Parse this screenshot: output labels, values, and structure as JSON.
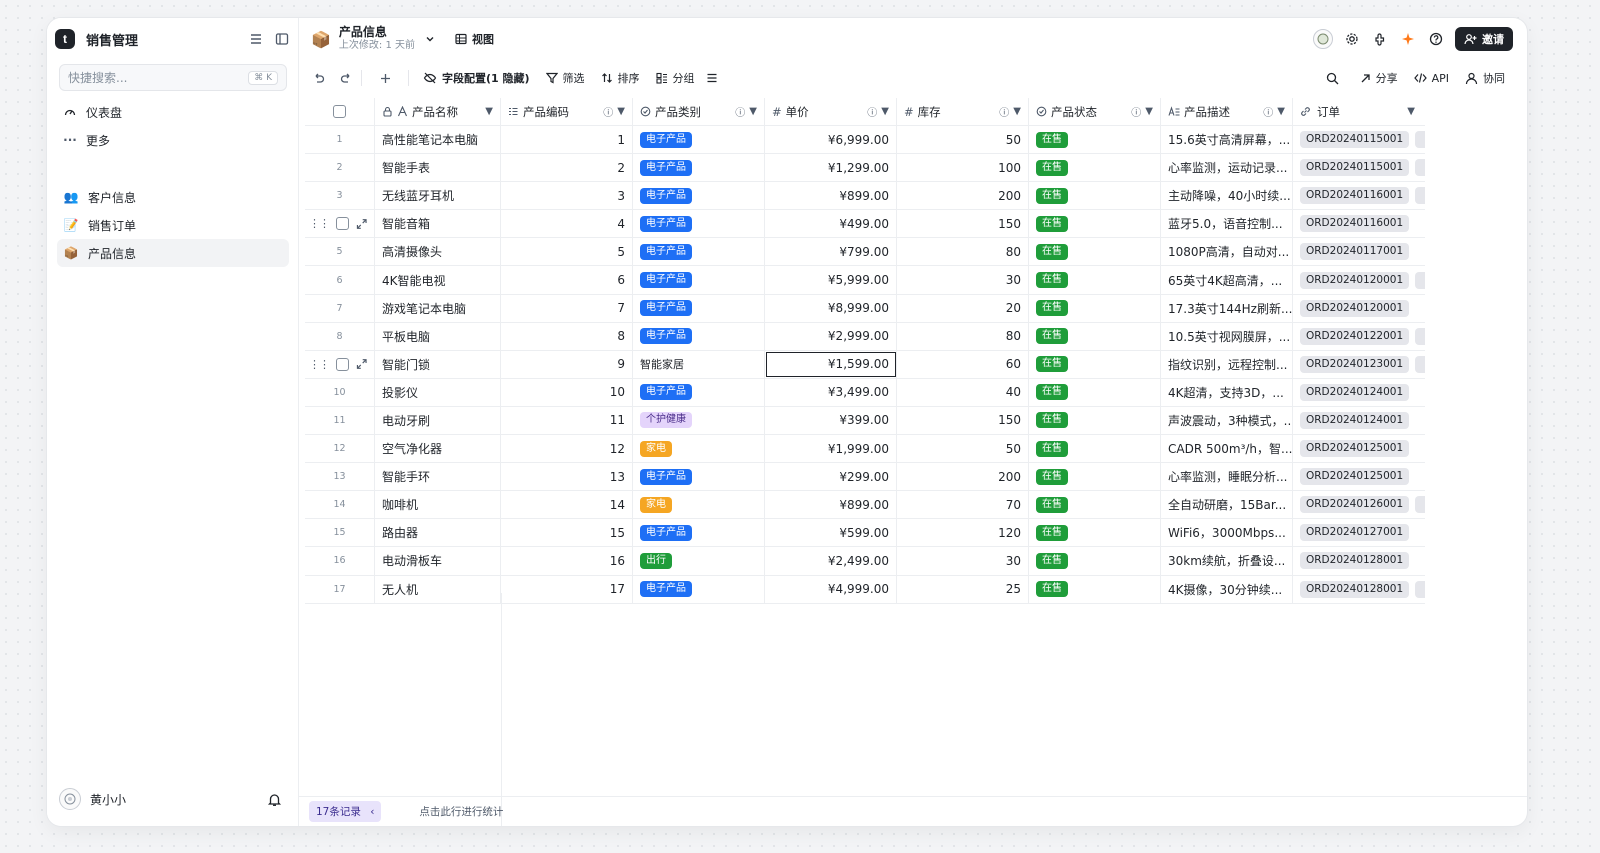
{
  "sidebar": {
    "app_logo": "t",
    "app_title": "销售管理",
    "search_placeholder": "快捷搜索...",
    "search_shortcut": "⌘ K",
    "top_items": [
      {
        "icon": "dashboard-icon",
        "label": "仪表盘"
      },
      {
        "icon": "more-icon",
        "label": "更多"
      }
    ],
    "tables": [
      {
        "emoji": "👥",
        "label": "客户信息"
      },
      {
        "emoji": "📝",
        "label": "销售订单"
      },
      {
        "emoji": "📦",
        "label": "产品信息"
      }
    ],
    "user_name": "黄小小"
  },
  "header": {
    "table_emoji": "📦",
    "table_title": "产品信息",
    "last_modified": "上次修改: 1 天前",
    "view_label": "视图",
    "invite_label": "邀请"
  },
  "toolbar": {
    "field_config": "字段配置(1 隐藏)",
    "filter": "筛选",
    "sort": "排序",
    "group": "分组",
    "share": "分享",
    "api": "API",
    "collab": "协同"
  },
  "columns": [
    "产品名称",
    "产品编码",
    "产品类别",
    "单价",
    "库存",
    "产品状态",
    "产品描述",
    "订单"
  ],
  "rows": [
    {
      "n": "1",
      "name": "高性能笔记本电脑",
      "code": "1",
      "cat": "电子产品",
      "catColor": "#1e6ff5",
      "price": "¥6,999.00",
      "stock": "50",
      "status": "在售",
      "desc": "15.6英寸高清屏幕，...",
      "order": "ORD20240115001",
      "more": true
    },
    {
      "n": "2",
      "name": "智能手表",
      "code": "2",
      "cat": "电子产品",
      "catColor": "#1e6ff5",
      "price": "¥1,299.00",
      "stock": "100",
      "status": "在售",
      "desc": "心率监测，运动记录...",
      "order": "ORD20240115001",
      "more": true
    },
    {
      "n": "3",
      "name": "无线蓝牙耳机",
      "code": "3",
      "cat": "电子产品",
      "catColor": "#1e6ff5",
      "price": "¥899.00",
      "stock": "200",
      "status": "在售",
      "desc": "主动降噪，40小时续...",
      "order": "ORD20240116001",
      "more": true
    },
    {
      "n": "",
      "name": "智能音箱",
      "code": "4",
      "cat": "电子产品",
      "catColor": "#1e6ff5",
      "price": "¥499.00",
      "stock": "150",
      "status": "在售",
      "desc": "蓝牙5.0，语音控制...",
      "order": "ORD20240116001",
      "more": false
    },
    {
      "n": "5",
      "name": "高清摄像头",
      "code": "5",
      "cat": "电子产品",
      "catColor": "#1e6ff5",
      "price": "¥799.00",
      "stock": "80",
      "status": "在售",
      "desc": "1080P高清，自动对...",
      "order": "ORD20240117001",
      "more": false
    },
    {
      "n": "6",
      "name": "4K智能电视",
      "code": "6",
      "cat": "电子产品",
      "catColor": "#1e6ff5",
      "price": "¥5,999.00",
      "stock": "30",
      "status": "在售",
      "desc": "65英寸4K超高清，...",
      "order": "ORD20240120001",
      "more": true
    },
    {
      "n": "7",
      "name": "游戏笔记本电脑",
      "code": "7",
      "cat": "电子产品",
      "catColor": "#1e6ff5",
      "price": "¥8,999.00",
      "stock": "20",
      "status": "在售",
      "desc": "17.3英寸144Hz刷新...",
      "order": "ORD20240120001",
      "more": false
    },
    {
      "n": "8",
      "name": "平板电脑",
      "code": "8",
      "cat": "电子产品",
      "catColor": "#1e6ff5",
      "price": "¥2,999.00",
      "stock": "80",
      "status": "在售",
      "desc": "10.5英寸视网膜屏，...",
      "order": "ORD20240122001",
      "more": true
    },
    {
      "n": "",
      "name": "智能门锁",
      "code": "9",
      "cat": "智能家居",
      "catColor": "",
      "price": "¥1,599.00",
      "stock": "60",
      "status": "在售",
      "desc": "指纹识别，远程控制...",
      "order": "ORD20240123001",
      "more": true
    },
    {
      "n": "10",
      "name": "投影仪",
      "code": "10",
      "cat": "电子产品",
      "catColor": "#1e6ff5",
      "price": "¥3,499.00",
      "stock": "40",
      "status": "在售",
      "desc": "4K超清，支持3D，...",
      "order": "ORD20240124001",
      "more": false
    },
    {
      "n": "11",
      "name": "电动牙刷",
      "code": "11",
      "cat": "个护健康",
      "catColor": "#e4d4fb",
      "price": "¥399.00",
      "stock": "150",
      "status": "在售",
      "desc": "声波震动，3种模式，...",
      "order": "ORD20240124001",
      "more": false
    },
    {
      "n": "12",
      "name": "空气净化器",
      "code": "12",
      "cat": "家电",
      "catColor": "#f5a623",
      "price": "¥1,999.00",
      "stock": "50",
      "status": "在售",
      "desc": "CADR 500m³/h，智...",
      "order": "ORD20240125001",
      "more": false
    },
    {
      "n": "13",
      "name": "智能手环",
      "code": "13",
      "cat": "电子产品",
      "catColor": "#1e6ff5",
      "price": "¥299.00",
      "stock": "200",
      "status": "在售",
      "desc": "心率监测，睡眠分析...",
      "order": "ORD20240125001",
      "more": false
    },
    {
      "n": "14",
      "name": "咖啡机",
      "code": "14",
      "cat": "家电",
      "catColor": "#f5a623",
      "price": "¥899.00",
      "stock": "70",
      "status": "在售",
      "desc": "全自动研磨，15Bar...",
      "order": "ORD20240126001",
      "more": true
    },
    {
      "n": "15",
      "name": "路由器",
      "code": "15",
      "cat": "电子产品",
      "catColor": "#1e6ff5",
      "price": "¥599.00",
      "stock": "120",
      "status": "在售",
      "desc": "WiFi6，3000Mbps...",
      "order": "ORD20240127001",
      "more": false
    },
    {
      "n": "16",
      "name": "电动滑板车",
      "code": "16",
      "cat": "出行",
      "catColor": "#1f9d3a",
      "price": "¥2,499.00",
      "stock": "30",
      "status": "在售",
      "desc": "30km续航，折叠设...",
      "order": "ORD20240128001",
      "more": false
    },
    {
      "n": "17",
      "name": "无人机",
      "code": "17",
      "cat": "电子产品",
      "catColor": "#1e6ff5",
      "price": "¥4,999.00",
      "stock": "25",
      "status": "在售",
      "desc": "4K摄像，30分钟续...",
      "order": "ORD20240128001",
      "more": true
    }
  ],
  "status_color": "#1f9d3a",
  "footer": {
    "record_count": "17条记录",
    "stats_hint": "点击此行进行统计"
  }
}
